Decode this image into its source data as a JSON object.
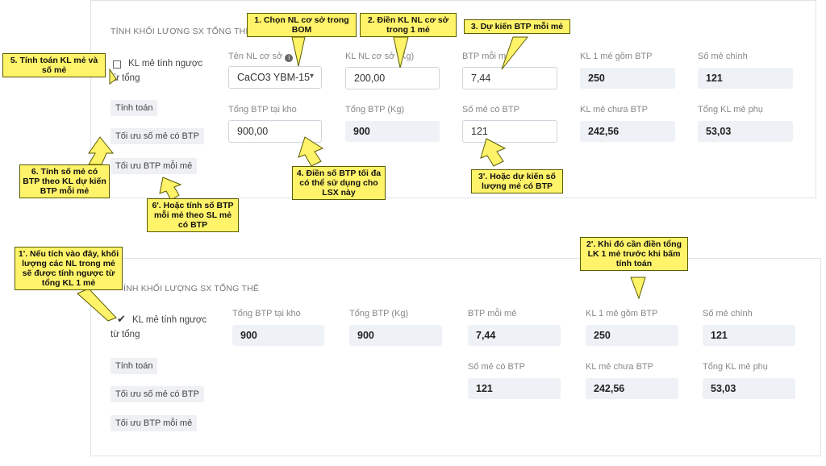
{
  "top": {
    "section_title": "TÍNH KHỐI LƯỢNG SX TỔNG THỂ",
    "checkbox_label": "KL mẻ tính ngược từ tổng",
    "btn_calc": "Tính toán",
    "btn_opt_batches": "Tối ưu số mẻ có BTP",
    "btn_opt_btp": "Tối ưu BTP mỗi mẻ",
    "fields": {
      "base_material_label": "Tên NL cơ sở",
      "base_material_value": "CaCO3 YBM-15",
      "base_qty_label": "KL NL cơ sở (Kg)",
      "base_qty_value": "200,00",
      "btp_per_batch_label": "BTP mỗi mẻ",
      "btp_per_batch_value": "7,44",
      "kl_batch_incl_label": "KL 1 mẻ gồm BTP",
      "kl_batch_incl_value": "250",
      "main_batches_label": "Số mẻ chính",
      "main_batches_value": "121",
      "btp_stock_label": "Tổng BTP tại kho",
      "btp_stock_value": "900,00",
      "btp_total_label": "Tổng BTP (Kg)",
      "btp_total_value": "900",
      "batches_btp_label": "Số mẻ có BTP",
      "batches_btp_value": "121",
      "kl_batch_excl_label": "KL mẻ chưa BTP",
      "kl_batch_excl_value": "242,56",
      "sub_total_label": "Tổng KL mẻ phụ",
      "sub_total_value": "53,03"
    }
  },
  "bottom": {
    "section_title": "ÍNH KHỐI LƯỢNG SX TỔNG THỂ",
    "checkbox_label": "KL mẻ tính ngược từ tổng",
    "btn_calc": "Tính toán",
    "btn_opt_batches": "Tối ưu số mẻ có BTP",
    "btn_opt_btp": "Tối ưu BTP mỗi mẻ",
    "fields": {
      "btp_stock_label": "Tổng BTP tại kho",
      "btp_stock_value": "900",
      "btp_total_label": "Tổng BTP (Kg)",
      "btp_total_value": "900",
      "btp_per_batch_label": "BTP mỗi mẻ",
      "btp_per_batch_value": "7,44",
      "kl_batch_incl_label": "KL 1 mẻ gồm BTP",
      "kl_batch_incl_value": "250",
      "main_batches_label": "Số mẻ chính",
      "main_batches_value": "121",
      "batches_btp_label": "Số mẻ có BTP",
      "batches_btp_value": "121",
      "kl_batch_excl_label": "KL mẻ chưa BTP",
      "kl_batch_excl_value": "242,56",
      "sub_total_label": "Tổng KL mẻ phụ",
      "sub_total_value": "53,03"
    }
  },
  "callouts": {
    "c1": "1. Chọn NL cơ sở trong BOM",
    "c2": "2. Điền KL NL cơ sở trong 1 mẻ",
    "c3": "3. Dự kiến BTP mỗi mẻ",
    "c4": "4. Điền số BTP tối đa có thể sử dụng cho LSX này",
    "c5": "5. Tính toán KL mẻ và số mẻ",
    "c6": "6. Tính số mẻ có BTP theo KL dự kiến BTP mỗi mẻ",
    "c3b": "3'. Hoặc dự kiến số lượng mẻ có BTP",
    "c6b": "6'. Hoặc tính số BTP mỗi mẻ theo SL mẻ có BTP",
    "c1b": "1'. Nếu tích vào đây, khối lượng các NL trong mẻ sẽ được tính ngược từ tổng KL 1 mẻ",
    "c2b": "2'. Khi đó cần điền tổng LK 1 mẻ trước khi bấm tính toán"
  },
  "icons": {
    "info": "info-circle-icon",
    "dropdown": "chevron-down-icon",
    "check": "checkmark-icon"
  },
  "colors": {
    "callout_bg": "#fff36a",
    "field_bg": "#eef1f5"
  }
}
